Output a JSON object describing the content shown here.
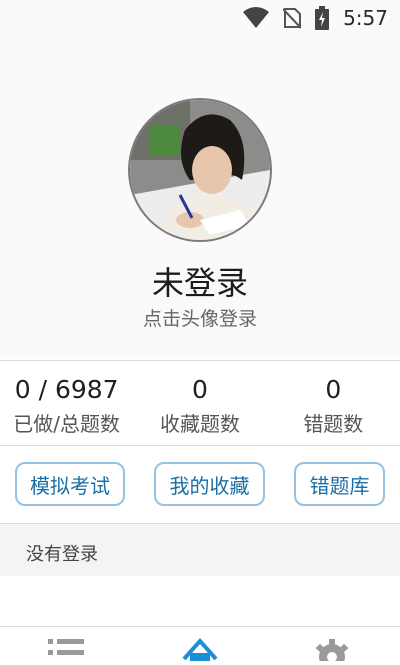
{
  "status_bar": {
    "time": "5:57",
    "icons": [
      "wifi-icon",
      "no-sim-icon",
      "battery-charging-icon"
    ]
  },
  "profile": {
    "avatar": "avatar-photo",
    "name": "未登录",
    "hint": "点击头像登录"
  },
  "stats": [
    {
      "value": "0 / 6987",
      "label": "已做/总题数"
    },
    {
      "value": "0",
      "label": "收藏题数"
    },
    {
      "value": "0",
      "label": "错题数"
    }
  ],
  "actions": [
    {
      "label": "模拟考试"
    },
    {
      "label": "我的收藏"
    },
    {
      "label": "错题库"
    }
  ],
  "message": "没有登录",
  "bottom_nav": {
    "items": [
      "list-icon",
      "home-icon",
      "gear-icon"
    ],
    "active_color": "#1a8fd6",
    "inactive_color": "#9a9a9a"
  }
}
